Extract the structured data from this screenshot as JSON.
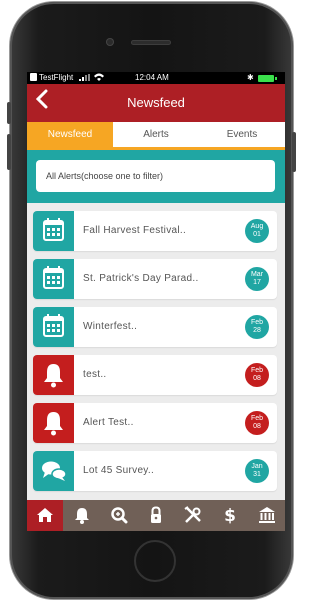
{
  "status_bar": {
    "carrier": "TestFlight",
    "time": "12:04 AM"
  },
  "header": {
    "title": "Newsfeed",
    "back_icon": "back-arrow-icon"
  },
  "tabs": [
    {
      "label": "Newsfeed",
      "active": true
    },
    {
      "label": "Alerts",
      "active": false
    },
    {
      "label": "Events",
      "active": false
    }
  ],
  "filter": {
    "label": "All Alerts(choose one to filter)"
  },
  "colors": {
    "header": "#ad1f25",
    "accent": "#f6a623",
    "teal": "#20a6a3",
    "alert_red": "#c41e1e",
    "tabbar": "#706057"
  },
  "items": [
    {
      "title": "Fall Harvest Festival..",
      "type": "event",
      "icon": "calendar-icon",
      "badge_month": "Aug",
      "badge_day": "01"
    },
    {
      "title": "St. Patrick's Day Parad..",
      "type": "event",
      "icon": "calendar-icon",
      "badge_month": "Mar",
      "badge_day": "17"
    },
    {
      "title": "Winterfest..",
      "type": "event",
      "icon": "calendar-icon",
      "badge_month": "Feb",
      "badge_day": "28"
    },
    {
      "title": "test..",
      "type": "alert",
      "icon": "bell-icon",
      "badge_month": "Feb",
      "badge_day": "08"
    },
    {
      "title": "Alert Test..",
      "type": "alert",
      "icon": "bell-icon",
      "badge_month": "Feb",
      "badge_day": "08"
    },
    {
      "title": "Lot 45 Survey..",
      "type": "survey",
      "icon": "chat-bubbles-icon",
      "badge_month": "Jan",
      "badge_day": "31"
    }
  ],
  "bottom_nav": [
    {
      "icon": "home-icon",
      "active": true
    },
    {
      "icon": "bell-icon",
      "active": false
    },
    {
      "icon": "search-icon",
      "active": false
    },
    {
      "icon": "lock-icon",
      "active": false
    },
    {
      "icon": "tools-icon",
      "active": false
    },
    {
      "icon": "dollar-icon",
      "active": false
    },
    {
      "icon": "bank-icon",
      "active": false
    }
  ]
}
